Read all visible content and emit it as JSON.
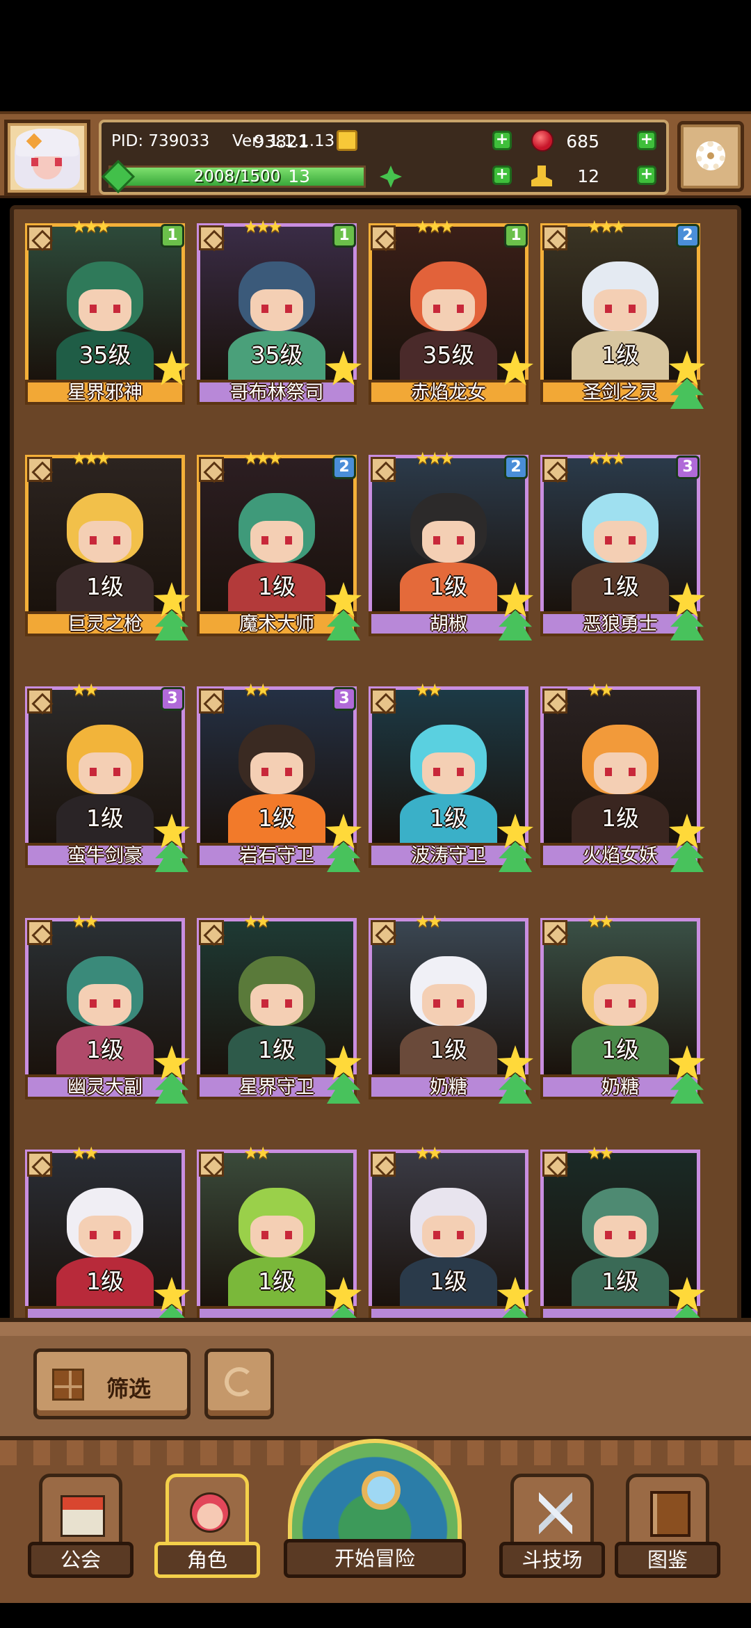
{
  "header": {
    "pid": "PID: 739033",
    "version": "Ver: 1.1.1.13",
    "gold": "93821",
    "gems": "685",
    "exp_text": "2008/1500",
    "exp_fraction": 1.0,
    "clover": "13",
    "stamina": "12",
    "plus": "+"
  },
  "roster": [
    {
      "name": "星界邪神",
      "level": "35级",
      "stars": "★★★",
      "badge": "1",
      "badge_color": "green",
      "frame": "gold"
    },
    {
      "name": "哥布林祭司",
      "level": "35级",
      "stars": "★★★",
      "badge": "1",
      "badge_color": "green",
      "frame": "purple"
    },
    {
      "name": "赤焰龙女",
      "level": "35级",
      "stars": "★★★",
      "badge": "1",
      "badge_color": "green",
      "frame": "gold"
    },
    {
      "name": "圣剑之灵",
      "level": "1级",
      "stars": "★★★",
      "badge": "2",
      "badge_color": "blue",
      "frame": "gold"
    },
    {
      "name": "巨灵之枪",
      "level": "1级",
      "stars": "★★★",
      "badge": "",
      "badge_color": "",
      "frame": "gold"
    },
    {
      "name": "魔术大师",
      "level": "1级",
      "stars": "★★★",
      "badge": "2",
      "badge_color": "blue",
      "frame": "gold"
    },
    {
      "name": "胡椒",
      "level": "1级",
      "stars": "★★★",
      "badge": "2",
      "badge_color": "blue",
      "frame": "purple"
    },
    {
      "name": "恶狼勇士",
      "level": "1级",
      "stars": "★★★",
      "badge": "3",
      "badge_color": "purple",
      "frame": "purple"
    },
    {
      "name": "蛮牛剑豪",
      "level": "1级",
      "stars": "★★",
      "badge": "3",
      "badge_color": "purple",
      "frame": "purple"
    },
    {
      "name": "岩石守卫",
      "level": "1级",
      "stars": "★★",
      "badge": "3",
      "badge_color": "purple",
      "frame": "purple"
    },
    {
      "name": "波涛守卫",
      "level": "1级",
      "stars": "★★",
      "badge": "",
      "badge_color": "",
      "frame": "purple"
    },
    {
      "name": "火焰女妖",
      "level": "1级",
      "stars": "★★",
      "badge": "",
      "badge_color": "",
      "frame": "purple"
    },
    {
      "name": "幽灵大副",
      "level": "1级",
      "stars": "★★",
      "badge": "",
      "badge_color": "",
      "frame": "purple"
    },
    {
      "name": "星界守卫",
      "level": "1级",
      "stars": "★★",
      "badge": "",
      "badge_color": "",
      "frame": "purple"
    },
    {
      "name": "奶糖",
      "level": "1级",
      "stars": "★★",
      "badge": "",
      "badge_color": "",
      "frame": "purple"
    },
    {
      "name": "奶糖",
      "level": "1级",
      "stars": "★★",
      "badge": "",
      "badge_color": "",
      "frame": "purple"
    },
    {
      "name": "",
      "level": "1级",
      "stars": "★★",
      "badge": "",
      "badge_color": "",
      "frame": "purple"
    },
    {
      "name": "",
      "level": "1级",
      "stars": "★★",
      "badge": "",
      "badge_color": "",
      "frame": "purple"
    },
    {
      "name": "",
      "level": "1级",
      "stars": "★★",
      "badge": "",
      "badge_color": "",
      "frame": "purple"
    },
    {
      "name": "",
      "level": "1级",
      "stars": "★★",
      "badge": "",
      "badge_color": "",
      "frame": "purple"
    }
  ],
  "filter": {
    "label": "筛选"
  },
  "nav": {
    "guild": "公会",
    "role": "角色",
    "adventure": "开始冒险",
    "arena": "斗技场",
    "codex": "图鉴"
  },
  "colors": {
    "gold_frame": "#f4b039",
    "purple_frame": "#c98ee0",
    "badge_green": "#6bc04a",
    "badge_blue": "#4a8ed8",
    "badge_purple": "#b06ad8"
  }
}
